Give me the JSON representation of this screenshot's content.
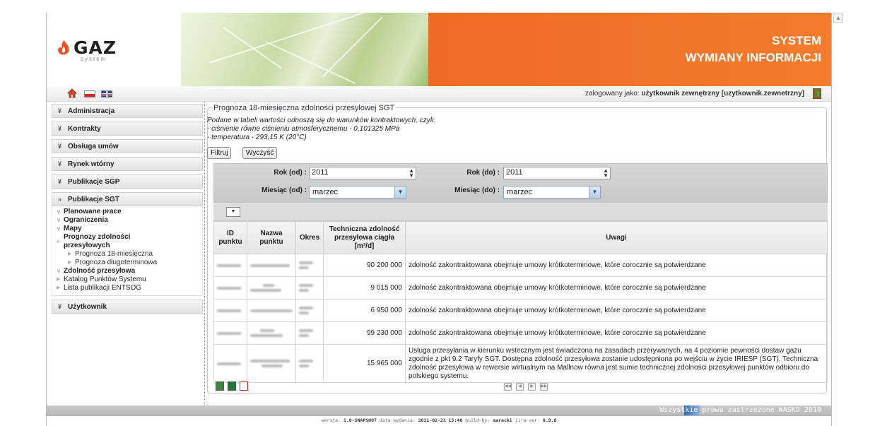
{
  "header": {
    "logo_text": "GAZ",
    "logo_sub": "system",
    "title_line1": "SYSTEM",
    "title_line2": "WYMIANY INFORMACJI",
    "accent_color": "#ee6a22"
  },
  "toolbar": {
    "icons": [
      "home-icon",
      "pl-flag-icon",
      "uk-flag-icon"
    ],
    "login_label": "zalogowany jako:",
    "login_user": "użytkownik zewnętrzny [uzytkownik.zewnetrzny]"
  },
  "sidebar": {
    "sections": [
      {
        "label": "Administracja"
      },
      {
        "label": "Kontrakty"
      },
      {
        "label": "Obsługa umów"
      },
      {
        "label": "Rynek wtórny"
      },
      {
        "label": "Publikacje SGP"
      },
      {
        "label": "Publikacje SGT"
      },
      {
        "label": "Użytkownik"
      }
    ],
    "sgt_items": [
      {
        "label": "Planowane prace"
      },
      {
        "label": "Ograniczenia"
      },
      {
        "label": "Mapy"
      },
      {
        "label": "Prognozy zdolności przesyłowych",
        "line1": "Prognozy zdolności",
        "line2": "przesyłowych"
      },
      {
        "label": "Prognoza 18-miesięczna"
      },
      {
        "label": "Prognoza długoterminowa"
      },
      {
        "label": "Zdolność przesyłowa"
      },
      {
        "label": "Katalog Punktów Systemu"
      },
      {
        "label": "Lista publikacji ENTSOG"
      }
    ]
  },
  "main": {
    "legend": "Prognoza 18-miesięczna zdolności przesyłowej SGT",
    "note_intro": "Podane w tabeli wartości odnoszą się do warunków kontraktowych, czyli:",
    "note_1": "- ciśnienie równe ciśnieniu atmosferycznemu - 0,101325 MPa",
    "note_2": "- temperatura - 293,15 K (20°C)",
    "filter_button": "Filtruj",
    "clear_button": "Wyczyść",
    "filters": {
      "year_from_label": "Rok (od) :",
      "year_from_value": "2011",
      "year_to_label": "Rok (do) :",
      "year_to_value": "2011",
      "month_from_label": "Miesiąc (od) :",
      "month_from_value": "marzec",
      "month_to_label": "Miesiąc (do) :",
      "month_to_value": "marzec"
    },
    "table": {
      "headers": [
        "ID punktu",
        "Nazwa punktu",
        "Okres",
        "Techniczna zdolność przesyłowa ciągła [m³/d]",
        "Uwagi"
      ],
      "rows": [
        {
          "capacity": "90 200 000",
          "remarks": "zdolność zakontraktowana obejmuje umowy krótkoterminowe, które corocznie są potwierdzane"
        },
        {
          "capacity": "9 015 000",
          "remarks": "zdolność zakontraktowana obejmuje umowy krótkoterminowe, które corocznie są potwierdzane"
        },
        {
          "capacity": "6 950 000",
          "remarks": "zdolność zakontraktowana obejmuje umowy krótkoterminowe, które corocznie są potwierdzane"
        },
        {
          "capacity": "99 230 000",
          "remarks": "zdolność zakontraktowana obejmuje umowy krótkoterminowe, które corocznie są potwierdzane"
        },
        {
          "capacity": "15 965 000",
          "remarks": "Usługa przesyłania w kierunku wstecznym jest świadczona na zasadach przerywanych, na 4 poziomie pewności dostaw gazu zgodnie z pkt 9.2 Taryfy SGT. Dostępna zdolność przesyłowa zostanie udostępniona po wejściu w życie IRIESP (SGT). Techniczna zdolność przesyłowa w rewersie wirtualnym na Mallnow równa jest sumie technicznej zdolności przesyłowej punktów odbioru do polskiego systemu."
        }
      ]
    },
    "export_icons": [
      "csv-export-icon",
      "excel-export-icon",
      "pdf-export-icon"
    ]
  },
  "footer": {
    "rights": "Wszystkie prawa zastrzeżone WASKO 2010",
    "version_prefix": "wersja:",
    "version": "1.0-SNAPSHOT",
    "date_prefix": "data wydania:",
    "date": "2011-02-21 15:40",
    "build_prefix": "build-by:",
    "build_by": "marecki",
    "jira_prefix": "jira-ver:",
    "jira": "0.9.0"
  }
}
